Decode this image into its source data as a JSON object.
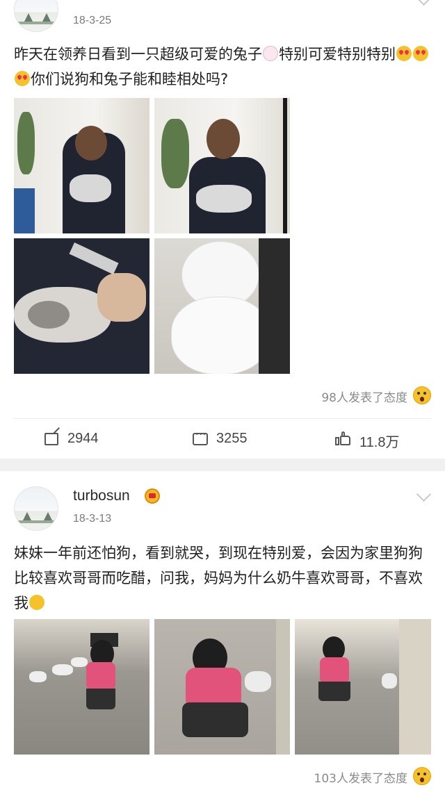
{
  "posts": [
    {
      "username": "",
      "date": "18-3-25",
      "text_part1": "昨天在领养日看到一只超级可爱的兔子",
      "text_part2": "特别可爱特别特别",
      "text_part3": "你们说狗和兔子能和睦相处吗?",
      "reactions": "98人发表了态度",
      "actions": {
        "repost": "2944",
        "comment": "3255",
        "like": "11.8万"
      }
    },
    {
      "username": "turbosun",
      "date": "18-3-13",
      "text_part1": "妹妹一年前还怕狗，看到就哭，到现在特别爱，会因为家里狗狗比较喜欢哥哥而吃醋，问我，妈妈为什么奶牛喜欢哥哥，不喜欢我",
      "reactions": "103人发表了态度"
    }
  ],
  "colors": {
    "accent": "#f5c22c",
    "text": "#1f1f1f",
    "muted": "#8a8a8a"
  }
}
